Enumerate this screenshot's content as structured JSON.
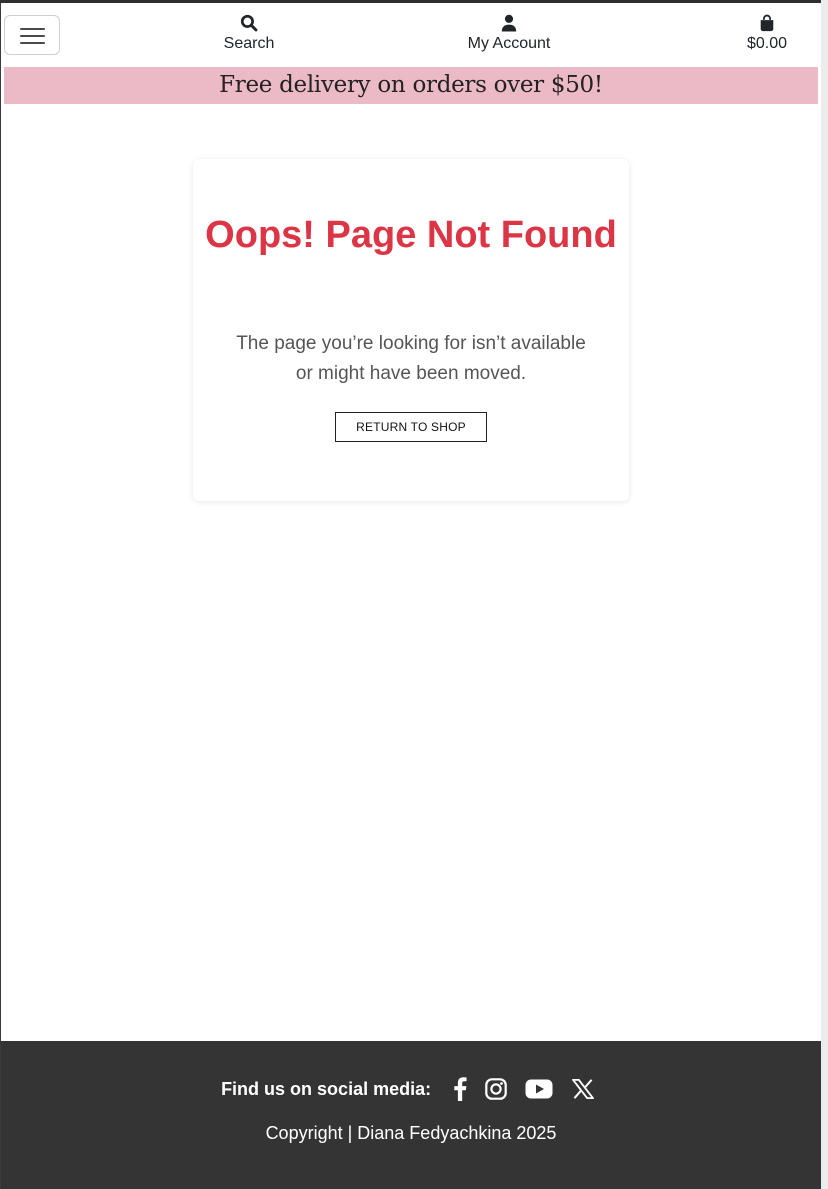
{
  "header": {
    "menu_icon": "hamburger-menu-icon",
    "search": {
      "icon": "search-icon",
      "label": "Search"
    },
    "account": {
      "icon": "user-icon",
      "label": "My Account"
    },
    "cart": {
      "icon": "shopping-bag-icon",
      "total": "$0.00"
    }
  },
  "promo": {
    "text": "Free delivery on orders over $50!",
    "background": "#ecbac7"
  },
  "error_card": {
    "title": "Oops! Page Not Found",
    "message": "The page you’re looking for isn’t available or might have been moved.",
    "button_label": "RETURN TO SHOP",
    "title_color": "#dc3545"
  },
  "footer": {
    "social_label": "Find us on social media:",
    "social_icons": [
      "facebook-icon",
      "instagram-icon",
      "youtube-icon",
      "x-icon"
    ],
    "copyright": "Copyright | Diana Fedyachkina 2025",
    "background": "#343434"
  }
}
